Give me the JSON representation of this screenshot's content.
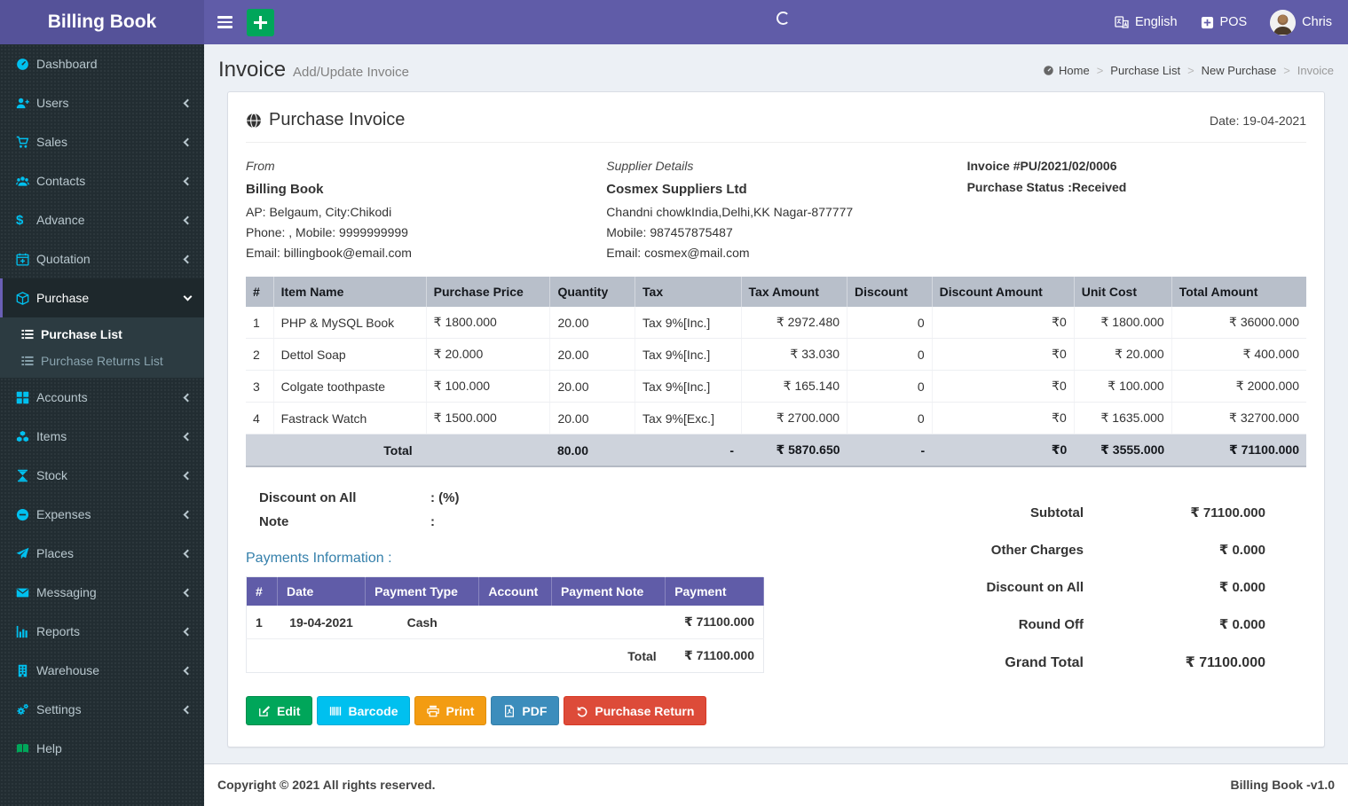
{
  "brand": {
    "name": "Billing Book"
  },
  "navbar": {
    "language": "English",
    "pos": "POS",
    "user": "Chris"
  },
  "sidebar": {
    "dollar_icon_char": "$",
    "items": [
      {
        "label": "Dashboard"
      },
      {
        "label": "Users"
      },
      {
        "label": "Sales"
      },
      {
        "label": "Contacts"
      },
      {
        "label": "Advance"
      },
      {
        "label": "Quotation"
      },
      {
        "label": "Purchase"
      },
      {
        "label": "Accounts"
      },
      {
        "label": "Items"
      },
      {
        "label": "Stock"
      },
      {
        "label": "Expenses"
      },
      {
        "label": "Places"
      },
      {
        "label": "Messaging"
      },
      {
        "label": "Reports"
      },
      {
        "label": "Warehouse"
      },
      {
        "label": "Settings"
      },
      {
        "label": "Help"
      }
    ],
    "purchase_submenu": [
      {
        "label": "Purchase List"
      },
      {
        "label": "Purchase Returns List"
      }
    ]
  },
  "page": {
    "title": "Invoice",
    "subtitle": "Add/Update Invoice",
    "separator": ">",
    "breadcrumb": [
      "Home",
      "Purchase List",
      "New Purchase",
      "Invoice"
    ]
  },
  "invoice": {
    "title": "Purchase Invoice",
    "date": "Date: 19-04-2021",
    "from": {
      "heading": "From",
      "name": "Billing Book",
      "address": "AP: Belgaum, City:Chikodi",
      "phone": "Phone: , Mobile: 9999999999",
      "email": "Email: billingbook@email.com"
    },
    "supplier": {
      "heading": "Supplier Details",
      "name": "Cosmex Suppliers Ltd",
      "address": "Chandni chowkIndia,Delhi,KK Nagar-877777",
      "phone": "Mobile: 987457875487",
      "email": "Email: cosmex@mail.com"
    },
    "meta": {
      "number": "Invoice #PU/2021/02/0006",
      "status": "Purchase Status :Received"
    },
    "items_table": {
      "headers": [
        "#",
        "Item Name",
        "Purchase Price",
        "Quantity",
        "Tax",
        "Tax Amount",
        "Discount",
        "Discount Amount",
        "Unit Cost",
        "Total Amount"
      ],
      "rows": [
        [
          "1",
          "PHP & MySQL Book",
          "₹ 1800.000",
          "20.00",
          "Tax 9%[Inc.]",
          "₹ 2972.480",
          "0",
          "₹0",
          "₹ 1800.000",
          "₹ 36000.000"
        ],
        [
          "2",
          "Dettol Soap",
          "₹ 20.000",
          "20.00",
          "Tax 9%[Inc.]",
          "₹ 33.030",
          "0",
          "₹0",
          "₹ 20.000",
          "₹ 400.000"
        ],
        [
          "3",
          "Colgate toothpaste",
          "₹ 100.000",
          "20.00",
          "Tax 9%[Inc.]",
          "₹ 165.140",
          "0",
          "₹0",
          "₹ 100.000",
          "₹ 2000.000"
        ],
        [
          "4",
          "Fastrack Watch",
          "₹ 1500.000",
          "20.00",
          "Tax 9%[Exc.]",
          "₹ 2700.000",
          "0",
          "₹0",
          "₹ 1635.000",
          "₹ 32700.000"
        ]
      ],
      "total": {
        "label": "Total",
        "quantity": "80.00",
        "tax": "-",
        "tax_amount": "₹ 5870.650",
        "discount": "-",
        "discount_amount": "₹0",
        "unit_cost": "₹ 3555.000",
        "total_amount": "₹ 71100.000"
      }
    },
    "discount_on_all": {
      "label": "Discount on All",
      "value": ": (%)"
    },
    "note": {
      "label": "Note",
      "value": ":"
    },
    "payments": {
      "heading": "Payments Information :",
      "headers": [
        "#",
        "Date",
        "Payment Type",
        "Account",
        "Payment Note",
        "Payment"
      ],
      "rows": [
        [
          "1",
          "19-04-2021",
          "Cash",
          "",
          "",
          "₹ 71100.000"
        ]
      ],
      "total_label": "Total",
      "total_value": "₹ 71100.000"
    },
    "summary": {
      "subtotal": {
        "label": "Subtotal",
        "value": "₹ 71100.000"
      },
      "other_charges": {
        "label": "Other Charges",
        "value": "₹ 0.000"
      },
      "discount_on_all": {
        "label": "Discount on All",
        "value": "₹ 0.000"
      },
      "round_off": {
        "label": "Round Off",
        "value": "₹ 0.000"
      },
      "grand_total": {
        "label": "Grand Total",
        "value": "₹ 71100.000"
      }
    },
    "actions": {
      "edit": "Edit",
      "barcode": "Barcode",
      "print": "Print",
      "pdf": "PDF",
      "purchase_return": "Purchase Return"
    }
  },
  "footer": {
    "copyright": "Copyright © 2021 All rights reserved.",
    "version": "Billing Book -v1.0"
  },
  "colors": {
    "navbar": "#605ca8",
    "logo_bg": "#555299",
    "sidebar_bg": "#222d32",
    "sidebar_icon": "#00c0ef",
    "items_table_header": "#b8bfca",
    "payments_table_header": "#605ca8",
    "btn_edit": "#00a65a",
    "btn_barcode": "#00c0ef",
    "btn_print": "#f39c12",
    "btn_pdf": "#3c8dbc",
    "btn_return": "#dd4b39"
  }
}
